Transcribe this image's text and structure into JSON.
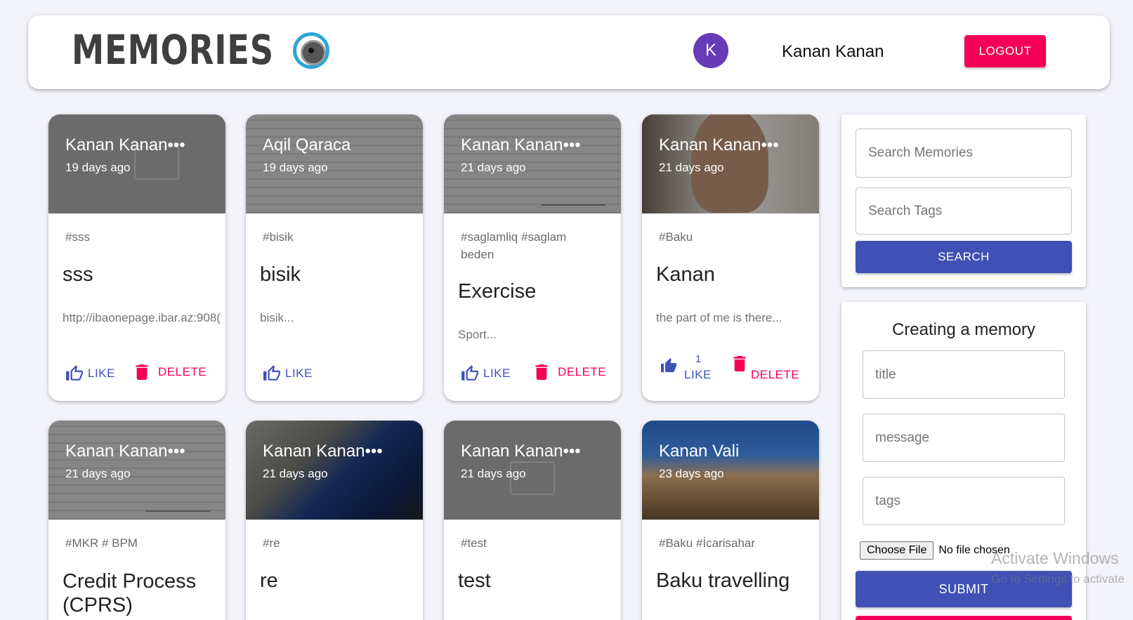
{
  "header": {
    "brand": "MEMORIES",
    "avatar_letter": "K",
    "user_name": "Kanan Kanan",
    "logout_label": "LOGOUT"
  },
  "posts": [
    {
      "author": "Kanan Kanan•••",
      "time": "19 days ago",
      "tags": "#sss",
      "title": "sss",
      "message": "http://ibaonepage.ibar.az:908(",
      "like_label": "LIKE",
      "delete_label": "DELETE"
    },
    {
      "author": "Aqil Qaraca",
      "time": "19 days ago",
      "tags": "#bisik",
      "title": "bisik",
      "message": "bisik...",
      "like_label": "LIKE"
    },
    {
      "author": "Kanan Kanan•••",
      "time": "21 days ago",
      "tags": "#saglamliq #saglam beden",
      "title": "Exercise",
      "message": "Sport...",
      "like_label": "LIKE",
      "delete_label": "DELETE"
    },
    {
      "author": "Kanan Kanan•••",
      "time": "21 days ago",
      "tags": "#Baku",
      "title": "Kanan",
      "message": "the part of me is there...",
      "like_count": "1",
      "like_label": "LIKE",
      "delete_label": "DELETE"
    },
    {
      "author": "Kanan Kanan•••",
      "time": "21 days ago",
      "tags": "#MKR # BPM",
      "title": "Credit Process (CPRS)"
    },
    {
      "author": "Kanan Kanan•••",
      "time": "21 days ago",
      "tags": "#re",
      "title": "re"
    },
    {
      "author": "Kanan Kanan•••",
      "time": "21 days ago",
      "tags": "#test",
      "title": "test"
    },
    {
      "author": "Kanan Vali",
      "time": "23 days ago",
      "tags": "#Baku #İcarisahar",
      "title": "Baku travelling"
    }
  ],
  "search": {
    "memories_placeholder": "Search Memories",
    "tags_placeholder": "Search Tags",
    "button_label": "SEARCH"
  },
  "form": {
    "title": "Creating a memory",
    "title_placeholder": "title",
    "message_placeholder": "message",
    "tags_placeholder": "tags",
    "choose_file_label": "Choose File",
    "no_file_label": "No file chosen",
    "submit_label": "SUBMIT"
  },
  "watermark": {
    "line1": "Activate Windows",
    "line2": "Go to Settings to activate"
  },
  "colors": {
    "primary": "#3f51b5",
    "secondary": "#f50057",
    "avatar": "#673ab7"
  }
}
